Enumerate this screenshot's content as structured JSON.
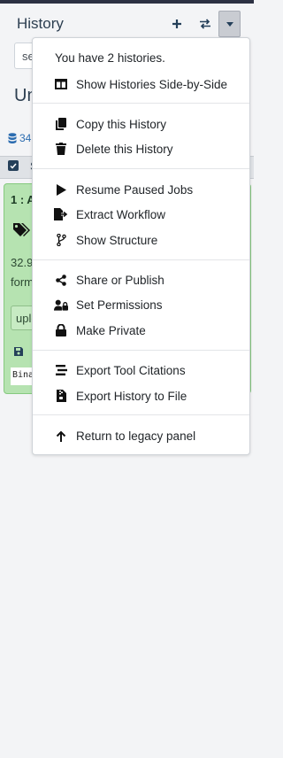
{
  "header": {
    "title": "History"
  },
  "search": {
    "value": "se"
  },
  "history": {
    "name": "Un",
    "size": "34",
    "select_label": "S"
  },
  "dataset": {
    "title": "1 : A",
    "info1": "32.9",
    "info2": "form",
    "button_label": "uplo",
    "peek": "Bina"
  },
  "menu": {
    "count_text": "You have 2 histories.",
    "items": [
      {
        "label": "Show Histories Side-by-Side",
        "icon": "columns-icon"
      },
      {
        "label": "Copy this History",
        "icon": "copy-icon"
      },
      {
        "label": "Delete this History",
        "icon": "trash-icon"
      },
      {
        "label": "Resume Paused Jobs",
        "icon": "play-icon"
      },
      {
        "label": "Extract Workflow",
        "icon": "file-export-icon"
      },
      {
        "label": "Show Structure",
        "icon": "code-branch-icon"
      },
      {
        "label": "Share or Publish",
        "icon": "share-icon"
      },
      {
        "label": "Set Permissions",
        "icon": "user-lock-icon"
      },
      {
        "label": "Make Private",
        "icon": "lock-icon"
      },
      {
        "label": "Export Tool Citations",
        "icon": "stream-icon"
      },
      {
        "label": "Export History to File",
        "icon": "file-archive-icon"
      },
      {
        "label": "Return to legacy panel",
        "icon": "arrow-up-icon"
      }
    ]
  },
  "colors": {
    "accent": "#25405a",
    "dataset_ok": "#b6e3b1",
    "topbar": "#2c3143"
  }
}
